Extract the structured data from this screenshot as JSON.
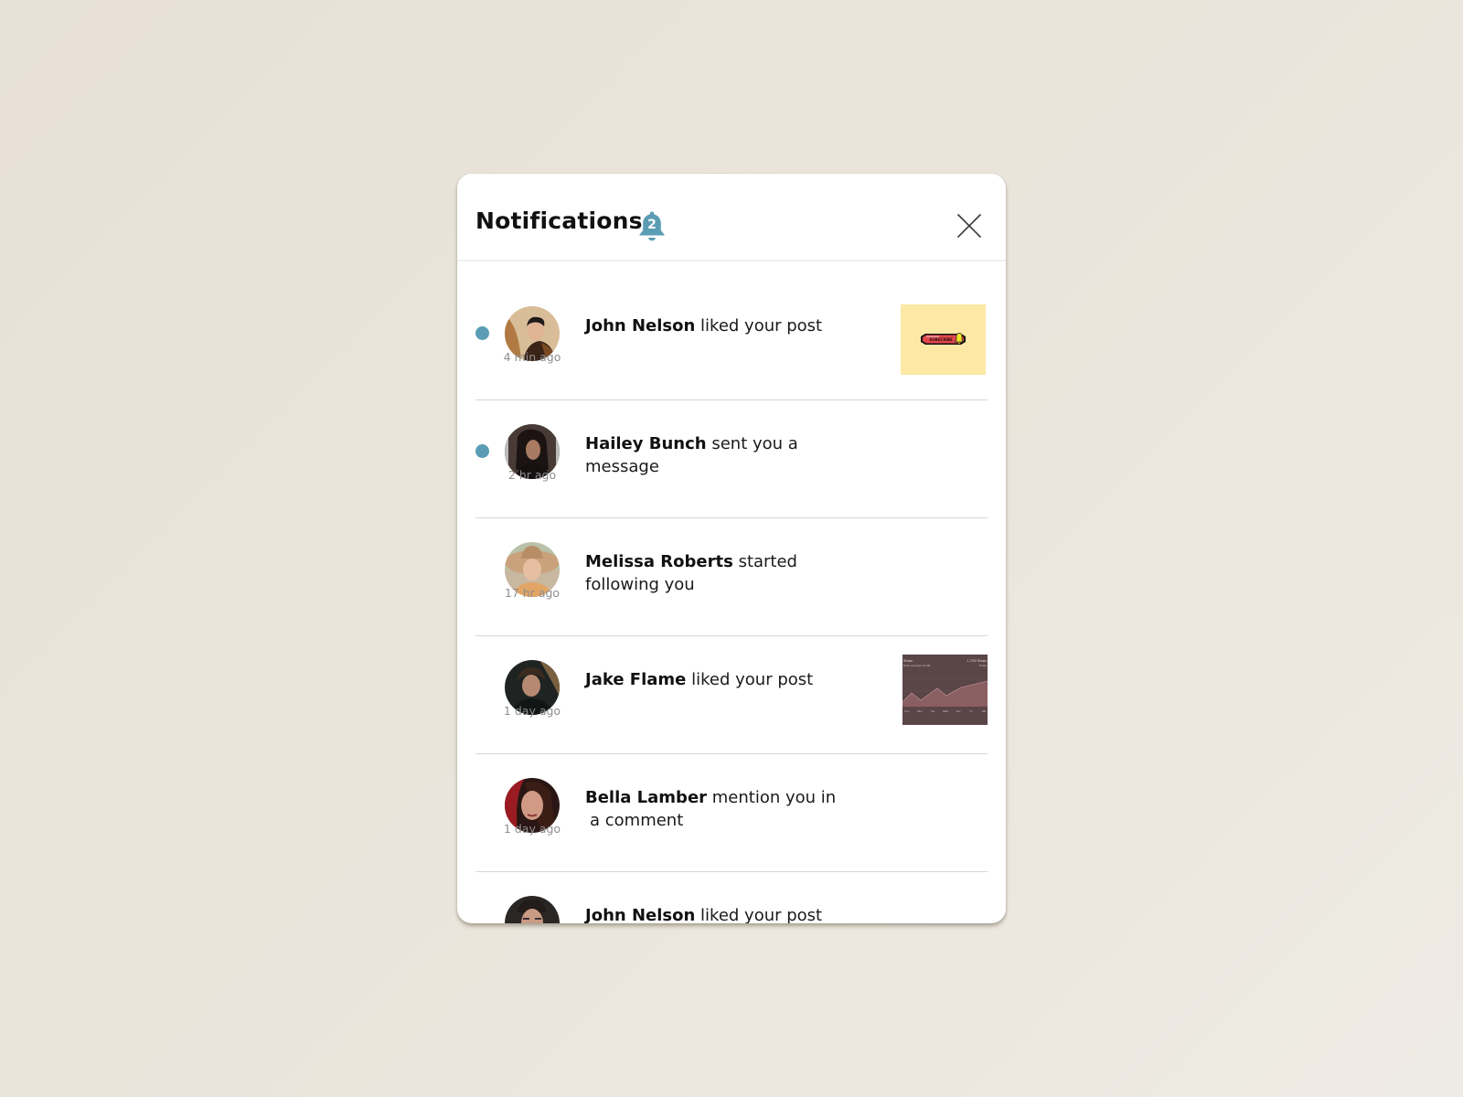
{
  "header": {
    "title": "Notifications",
    "unread_count": "2",
    "bell_icon": "bell-icon",
    "close_icon": "close-icon"
  },
  "colors": {
    "accent": "#5b9db4",
    "unread_dot": "#5b9db4",
    "divider": "#d6d6d6",
    "timestamp": "#8e8e8e",
    "thumb_yellow": "#fde8a5",
    "thumb_chart": "#5a4547"
  },
  "notifications": [
    {
      "name": "John Nelson",
      "action": "liked your post",
      "time": "4 min ago",
      "unread": true,
      "thumbnail": "subscribe-button-image"
    },
    {
      "name": "Hailey Bunch",
      "action": "sent you a message",
      "time": "2 hr ago",
      "unread": true,
      "thumbnail": null
    },
    {
      "name": "Melissa Roberts",
      "action": "started following you",
      "time": "17 hr ago",
      "unread": false,
      "thumbnail": null
    },
    {
      "name": "Jake Flame",
      "action": "liked your post",
      "time": "1 day ago",
      "unread": false,
      "thumbnail": "steps-chart-image"
    },
    {
      "name": "Bella Lamber",
      "action": "mention you in  a comment",
      "action_line1": "mention you in",
      "action_line2": "a comment",
      "time": "1 day ago",
      "unread": false,
      "thumbnail": null
    },
    {
      "name": "John Nelson",
      "action": "liked your post",
      "time": "",
      "unread": false,
      "thumbnail": null
    }
  ],
  "thumbnails": {
    "subscribe": {
      "label": "SUBSCRIBE"
    },
    "chart": {
      "title": "Steps",
      "subtitle": "Daily average: 8,196",
      "total": "1,750 Steps",
      "total_sub": "Today",
      "days": [
        "Sun",
        "Mon",
        "Tue",
        "Wed",
        "Thu",
        "Fri",
        "Sat"
      ]
    }
  }
}
